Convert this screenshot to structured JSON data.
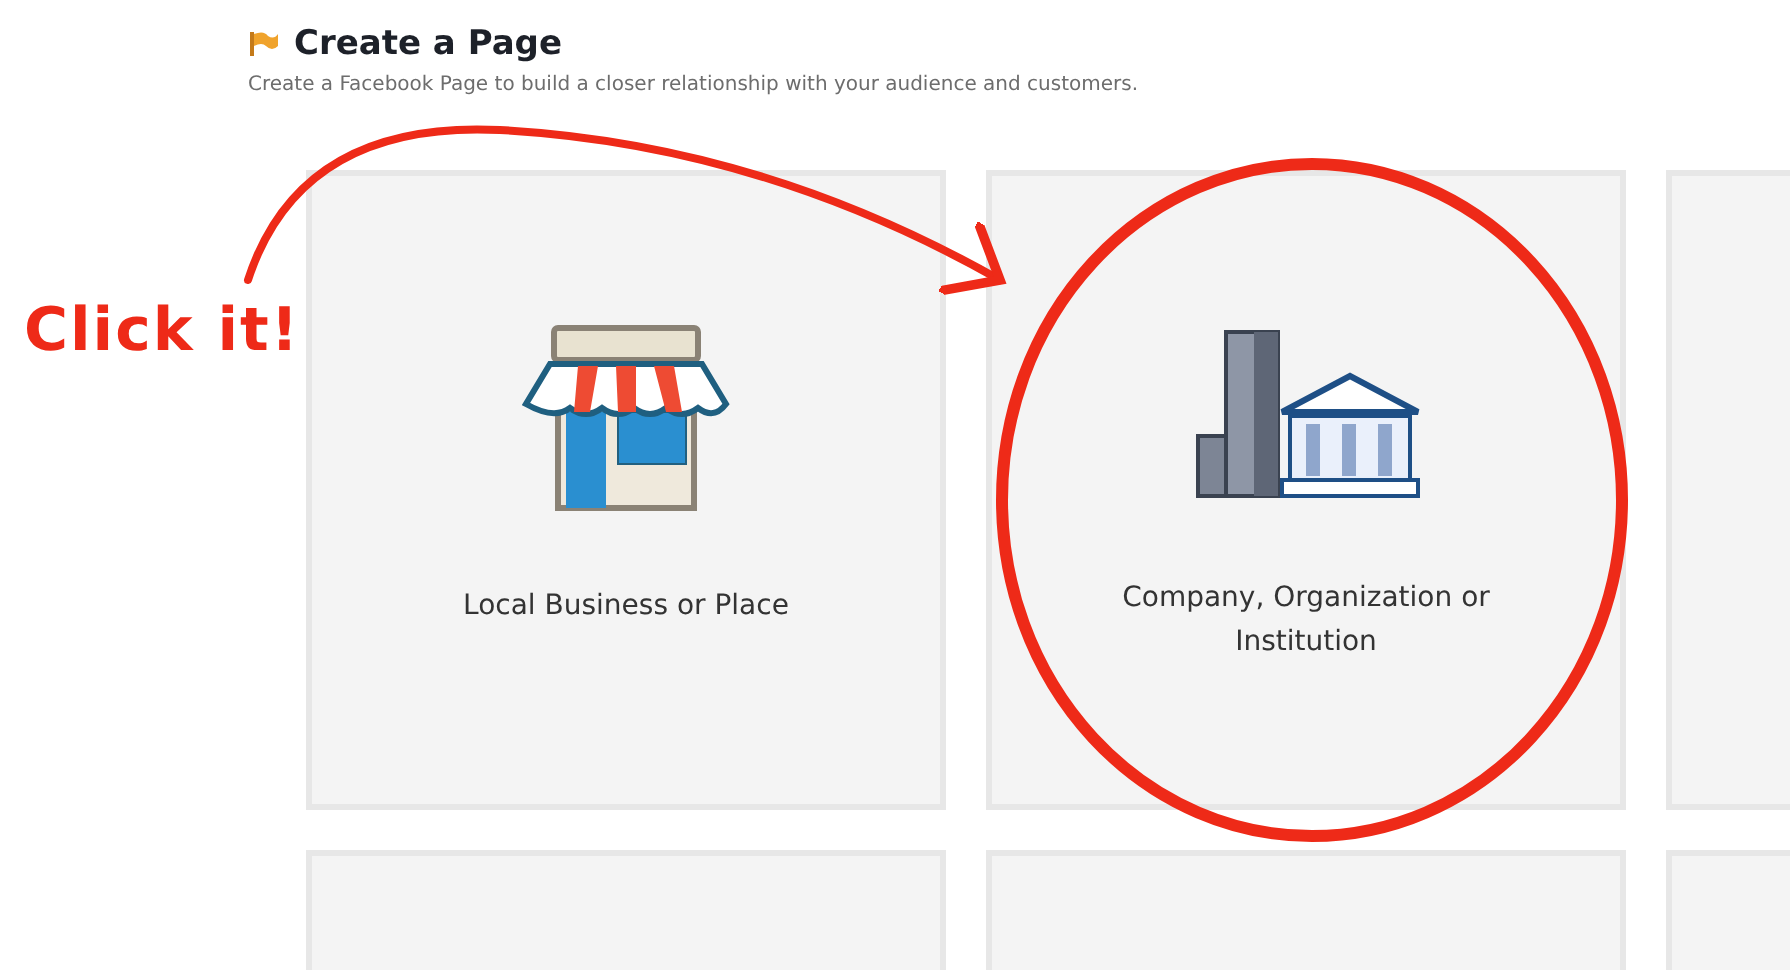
{
  "header": {
    "title": "Create a Page",
    "subtitle": "Create a Facebook Page to build a closer relationship with your audience and customers."
  },
  "cards": [
    {
      "kind": "store",
      "label": "Local Business or Place"
    },
    {
      "kind": "company",
      "label": "Company, Organization or Institution"
    },
    {
      "kind": "blank"
    },
    {
      "kind": "blank"
    },
    {
      "kind": "blank"
    },
    {
      "kind": "blank"
    }
  ],
  "annotation": {
    "text": "Click it!"
  }
}
